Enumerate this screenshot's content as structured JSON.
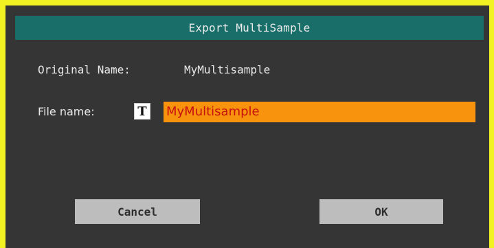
{
  "dialog": {
    "title": "Export MultiSample",
    "original_name_label": "Original Name:",
    "original_name_value": "MyMultisample",
    "file_name_label": "File name:",
    "text_edit_icon_glyph": "T",
    "file_name_value": "MyMultisample",
    "cancel_label": "Cancel",
    "ok_label": "OK"
  },
  "colors": {
    "frame": "#f2f222",
    "dialog_background": "#353535",
    "title_bar": "#1a6e6a",
    "input_background": "#f7930c",
    "input_text": "#c71010",
    "button_background": "#bdbdbd"
  },
  "icons": {
    "text_edit": "text-edit-icon"
  }
}
